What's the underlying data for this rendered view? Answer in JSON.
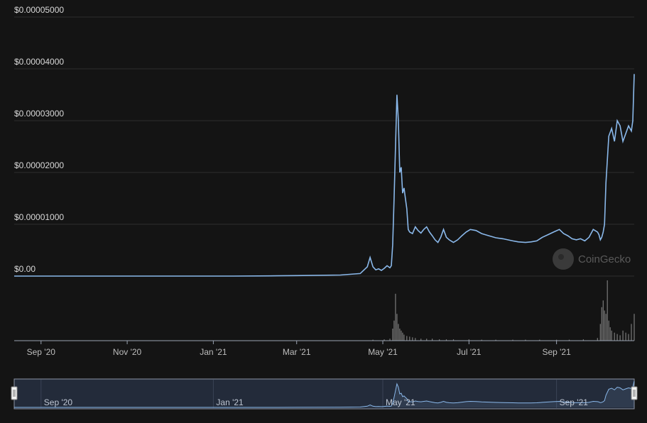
{
  "chart_data": {
    "type": "line",
    "title": "",
    "xlabel": "",
    "ylabel": "",
    "y_ticks": [
      "$0.00",
      "$0.00001000",
      "$0.00002000",
      "$0.00003000",
      "$0.00004000",
      "$0.00005000"
    ],
    "y_tick_values": [
      0,
      1e-05,
      2e-05,
      3e-05,
      4e-05,
      5e-05
    ],
    "ylim": [
      0,
      5e-05
    ],
    "x_ticks": [
      "Sep '20",
      "Nov '20",
      "Jan '21",
      "Mar '21",
      "May '21",
      "Jul '21",
      "Sep '21"
    ],
    "x_tick_dates": [
      "2020-09-01",
      "2020-11-01",
      "2021-01-01",
      "2021-03-01",
      "2021-05-01",
      "2021-07-01",
      "2021-09-01"
    ],
    "xlim": [
      "2020-08-13",
      "2021-10-26"
    ],
    "grid": true,
    "legend": "none",
    "series": [
      {
        "color": "#8ab8ea",
        "x": [
          "2020-08-13",
          "2020-10-01",
          "2020-12-01",
          "2021-01-15",
          "2021-02-15",
          "2021-03-01",
          "2021-04-01",
          "2021-04-15",
          "2021-04-20",
          "2021-04-22",
          "2021-04-24",
          "2021-04-26",
          "2021-04-28",
          "2021-04-30",
          "2021-05-02",
          "2021-05-04",
          "2021-05-06",
          "2021-05-07",
          "2021-05-08",
          "2021-05-09",
          "2021-05-10",
          "2021-05-11",
          "2021-05-12",
          "2021-05-13",
          "2021-05-14",
          "2021-05-15",
          "2021-05-16",
          "2021-05-17",
          "2021-05-18",
          "2021-05-19",
          "2021-05-20",
          "2021-05-22",
          "2021-05-24",
          "2021-05-26",
          "2021-05-28",
          "2021-05-30",
          "2021-06-01",
          "2021-06-03",
          "2021-06-05",
          "2021-06-07",
          "2021-06-09",
          "2021-06-11",
          "2021-06-13",
          "2021-06-15",
          "2021-06-17",
          "2021-06-20",
          "2021-06-23",
          "2021-06-26",
          "2021-06-29",
          "2021-07-02",
          "2021-07-06",
          "2021-07-10",
          "2021-07-15",
          "2021-07-20",
          "2021-07-25",
          "2021-08-01",
          "2021-08-05",
          "2021-08-10",
          "2021-08-14",
          "2021-08-18",
          "2021-08-22",
          "2021-08-26",
          "2021-08-30",
          "2021-09-03",
          "2021-09-06",
          "2021-09-09",
          "2021-09-12",
          "2021-09-15",
          "2021-09-18",
          "2021-09-21",
          "2021-09-24",
          "2021-09-27",
          "2021-09-30",
          "2021-10-01",
          "2021-10-02",
          "2021-10-03",
          "2021-10-04",
          "2021-10-05",
          "2021-10-06",
          "2021-10-08",
          "2021-10-10",
          "2021-10-12",
          "2021-10-14",
          "2021-10-16",
          "2021-10-18",
          "2021-10-20",
          "2021-10-22",
          "2021-10-24",
          "2021-10-25",
          "2021-10-26"
        ],
        "y": [
          0,
          0,
          0,
          0,
          5e-08,
          1e-07,
          2e-07,
          5e-07,
          1.8e-06,
          3.6e-06,
          1.8e-06,
          1.2e-06,
          1.4e-06,
          1.1e-06,
          1.5e-06,
          2e-06,
          1.6e-06,
          2e-06,
          6e-06,
          1.5e-05,
          2.5e-05,
          3.5e-05,
          3e-05,
          2e-05,
          2.1e-05,
          1.6e-05,
          1.7e-05,
          1.5e-05,
          1.3e-05,
          9e-06,
          8.5e-06,
          8.2e-06,
          9.5e-06,
          8.8e-06,
          8.3e-06,
          9e-06,
          9.5e-06,
          8.5e-06,
          7.8e-06,
          7e-06,
          6.5e-06,
          7.5e-06,
          9e-06,
          7.5e-06,
          7e-06,
          6.5e-06,
          7e-06,
          7.8e-06,
          8.5e-06,
          9e-06,
          8.8e-06,
          8.2e-06,
          7.8e-06,
          7.4e-06,
          7.2e-06,
          6.8e-06,
          6.6e-06,
          6.5e-06,
          6.6e-06,
          6.8e-06,
          7.5e-06,
          8e-06,
          8.5e-06,
          9e-06,
          8.2e-06,
          7.8e-06,
          7.2e-06,
          7e-06,
          7.2e-06,
          6.8e-06,
          7.5e-06,
          9e-06,
          8.5e-06,
          8e-06,
          7e-06,
          7.5e-06,
          8.5e-06,
          1e-05,
          1.8e-05,
          2.7e-05,
          2.85e-05,
          2.6e-05,
          3e-05,
          2.9e-05,
          2.6e-05,
          2.75e-05,
          2.9e-05,
          2.8e-05,
          3e-05,
          3.9e-05
        ]
      }
    ],
    "volume": {
      "color": "#7a7a7a",
      "x": [
        "2020-09-01",
        "2020-11-01",
        "2021-01-01",
        "2021-03-01",
        "2021-04-15",
        "2021-04-24",
        "2021-05-02",
        "2021-05-06",
        "2021-05-08",
        "2021-05-09",
        "2021-05-10",
        "2021-05-11",
        "2021-05-12",
        "2021-05-13",
        "2021-05-14",
        "2021-05-15",
        "2021-05-16",
        "2021-05-18",
        "2021-05-20",
        "2021-05-22",
        "2021-05-24",
        "2021-05-28",
        "2021-06-01",
        "2021-06-05",
        "2021-06-10",
        "2021-06-15",
        "2021-06-20",
        "2021-07-01",
        "2021-07-10",
        "2021-07-20",
        "2021-08-01",
        "2021-08-10",
        "2021-08-20",
        "2021-09-01",
        "2021-09-10",
        "2021-09-20",
        "2021-09-30",
        "2021-10-02",
        "2021-10-03",
        "2021-10-04",
        "2021-10-05",
        "2021-10-06",
        "2021-10-07",
        "2021-10-08",
        "2021-10-09",
        "2021-10-10",
        "2021-10-12",
        "2021-10-14",
        "2021-10-16",
        "2021-10-18",
        "2021-10-20",
        "2021-10-22",
        "2021-10-24",
        "2021-10-26"
      ],
      "values": [
        0.2,
        0.2,
        0.2,
        0.3,
        0.5,
        1.5,
        2,
        3,
        18,
        30,
        70,
        40,
        25,
        18,
        15,
        12,
        9,
        7,
        6,
        5,
        4,
        3,
        3,
        3,
        2,
        2,
        2,
        2,
        1.5,
        1.5,
        1.5,
        1.5,
        1.5,
        1.5,
        1.5,
        2,
        4,
        25,
        50,
        60,
        45,
        40,
        90,
        30,
        20,
        15,
        12,
        10,
        8,
        15,
        12,
        10,
        25,
        40
      ]
    }
  },
  "watermark": "CoinGecko",
  "navigator": {
    "labels": [
      "Sep '20",
      "Jan '21",
      "May '21",
      "Sep '21"
    ],
    "label_dates": [
      "2020-09-01",
      "2021-01-01",
      "2021-05-01",
      "2021-09-01"
    ]
  }
}
